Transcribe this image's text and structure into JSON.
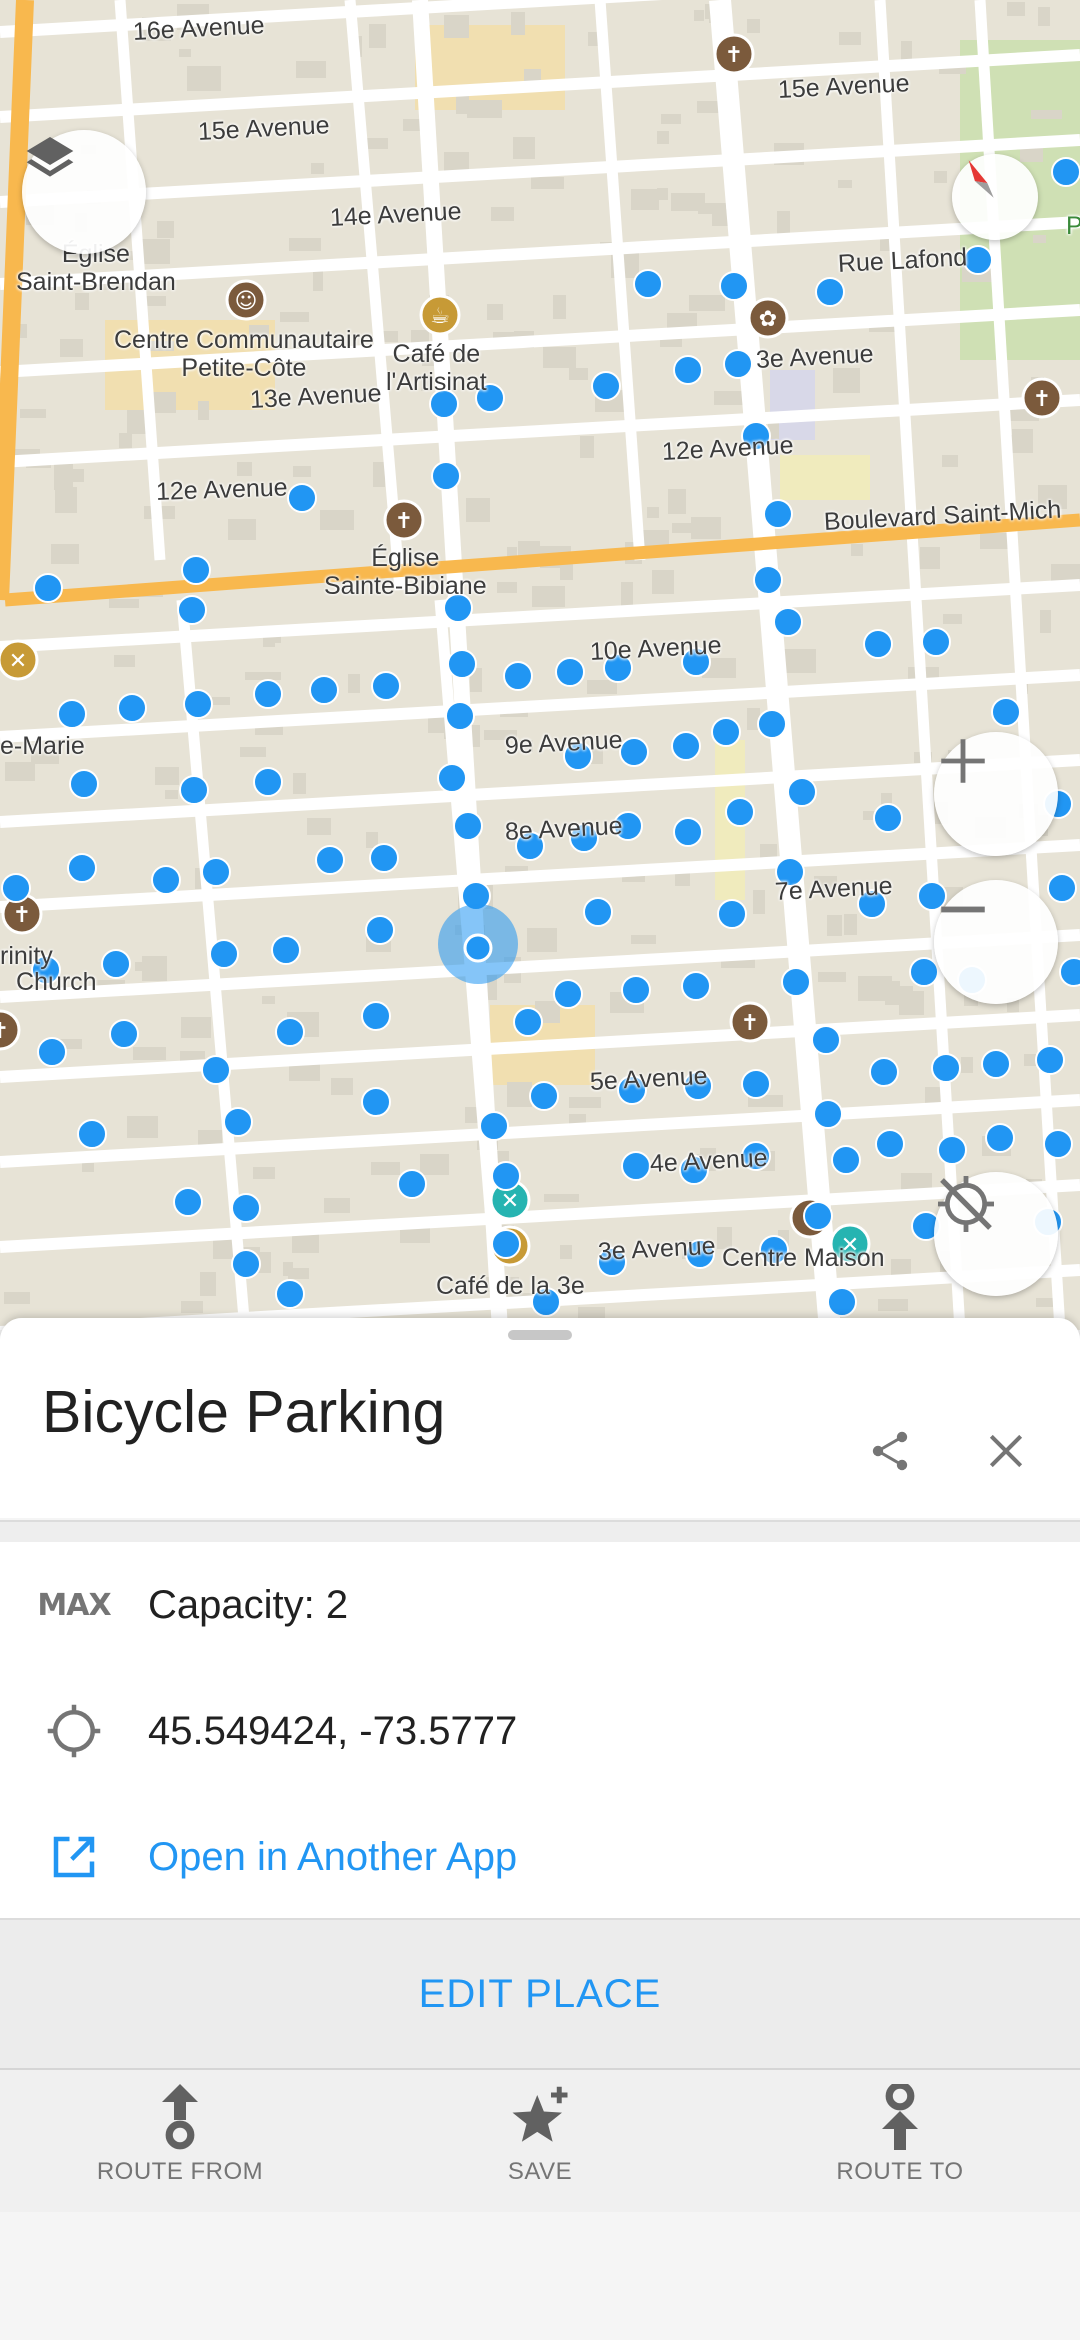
{
  "map": {
    "labels": {
      "ave16": "16e Avenue",
      "ave15a": "15e Avenue",
      "ave15b": "15e Avenue",
      "ave14": "14e Avenue",
      "ave13": "13e Avenue",
      "ave13b": "3e Avenue",
      "ave12a": "12e Avenue",
      "ave12b": "12e Avenue",
      "ave10": "10e Avenue",
      "ave9": "9e Avenue",
      "ave8": "8e Avenue",
      "ave7": "7e Avenue",
      "ave5": "5e Avenue",
      "ave4": "4e Avenue",
      "ave3": "3e Avenue",
      "rue_lafond": "Rue Lafond",
      "blvd": "Boulevard Saint-Mich",
      "eglise_brendan": "Église\nSaint-Brendan",
      "centre": "Centre Communautaire\nPetite-Côte",
      "cafe_artisinat": "Café de\nl'Artisinat",
      "eglise_bibiane": "Église\nSainte-Bibiane",
      "marie": "e-Marie",
      "trinity": "rinity",
      "church": "Church",
      "cafe_3e": "Café de la 3e",
      "centre_maison": "Centre Maison",
      "p_edge": "P"
    },
    "colors": {
      "bike_point": "#2196f3",
      "road_major": "#f8b84e",
      "road_minor": "#ffffff",
      "land": "#e7e3d6",
      "park": "#cfe0b4",
      "church_pin": "#7b5a3c",
      "cafe_pin": "#c79a36",
      "restaurant_pin": "#26b4b1"
    },
    "icons": [
      "layers-icon",
      "compass-icon",
      "zoom-in-icon",
      "zoom-out-icon",
      "location-off-icon"
    ]
  },
  "sheet": {
    "title": "Bicycle Parking",
    "actions": [
      "share-icon",
      "close-icon"
    ],
    "details": {
      "capacity_icon": "MAX",
      "capacity": "Capacity: 2",
      "coordinates": "45.549424, -73.5777",
      "open_app": "Open in Another App"
    },
    "edit_place": "EDIT PLACE",
    "bottom": {
      "route_from": "ROUTE FROM",
      "save": "SAVE",
      "route_to": "ROUTE TO"
    }
  }
}
